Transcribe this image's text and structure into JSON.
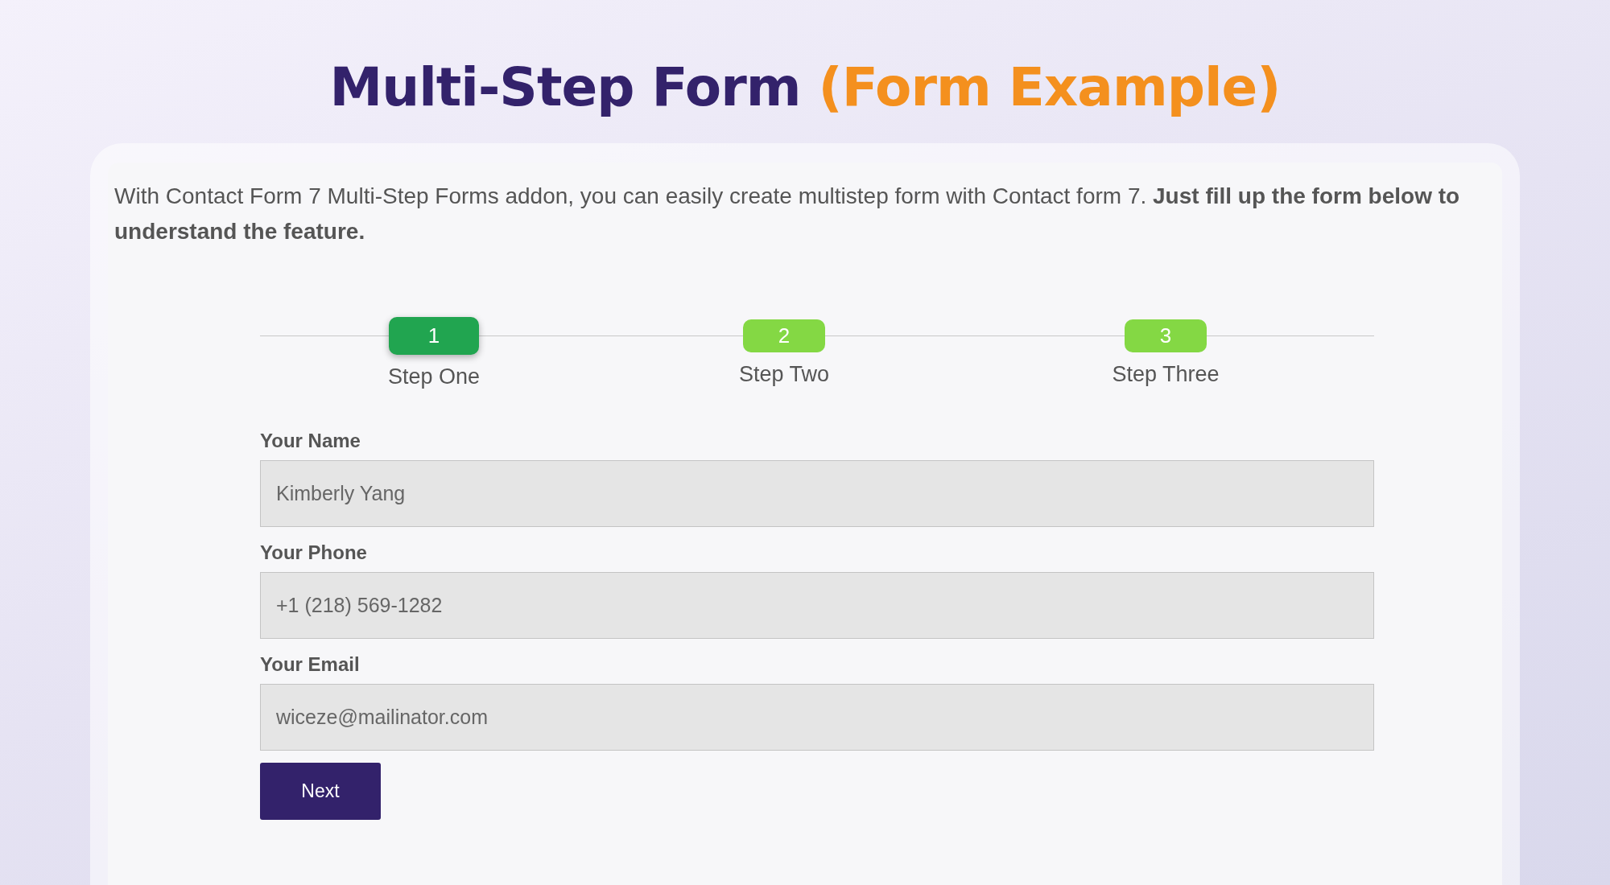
{
  "heading": {
    "title": "Multi-Step Form",
    "highlight": "(Form Example)"
  },
  "intro": "With Contact Form 7 Multi-Step Forms addon, you can easily create multistep form with Contact form 7. **Just fill up the form below to understand the feature.**",
  "steps": [
    {
      "number": "1",
      "label": "Step One",
      "selected": true
    },
    {
      "number": "2",
      "label": "Step Two",
      "selected": false
    },
    {
      "number": "3",
      "label": "Step Three",
      "selected": false
    }
  ],
  "fields": [
    {
      "label": "Your Name",
      "value": "Kimberly Yang"
    },
    {
      "label": "Your Phone",
      "value": "+1 (218) 569-1282"
    },
    {
      "label": "Your Email",
      "value": "wiceze@mailinator.com"
    }
  ],
  "button": "Next"
}
